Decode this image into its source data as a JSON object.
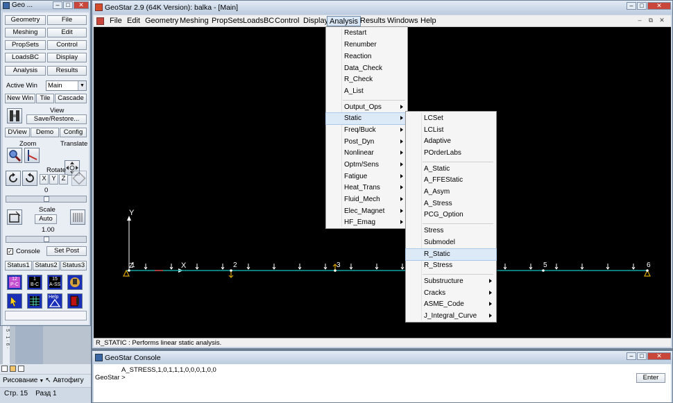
{
  "tool_window": {
    "title": "Geo ...",
    "buttons": [
      [
        "Geometry",
        "File"
      ],
      [
        "Meshing",
        "Edit"
      ],
      [
        "PropSets",
        "Control"
      ],
      [
        "LoadsBC",
        "Display"
      ],
      [
        "Analysis",
        "Results"
      ]
    ],
    "active_win_label": "Active Win",
    "active_win_value": "Main",
    "win_buttons": [
      "New Win",
      "Tile",
      "Cascade"
    ],
    "view_label": "View",
    "save_restore": "Save/Restore...",
    "view_buttons": [
      "DView",
      "Demo",
      "Config"
    ],
    "zoom_label": "Zoom",
    "translate_label": "Translate",
    "rotate_label": "Rotate",
    "axes": [
      "X",
      "Y",
      "Z"
    ],
    "rotate_value": "0",
    "scale_label": "Scale",
    "scale_auto": "Auto",
    "scale_value": "1.00",
    "console_checkbox": "Console",
    "set_post": "Set Post",
    "status_buttons": [
      "Status1",
      "Status2",
      "Status3"
    ],
    "badge_texts": [
      "12\nP-C",
      "1\nB-C",
      "15\nA-SS",
      "Help"
    ]
  },
  "main_window": {
    "title": "GeoStar 2.9 (64K Version): balka - [Main]",
    "menu": [
      "File",
      "Edit",
      "Geometry",
      "Meshing",
      "PropSets",
      "LoadsBC",
      "Control",
      "Display",
      "Analysis",
      "Results",
      "Windows",
      "Help"
    ],
    "active_menu": "Analysis",
    "status_text": "R_STATIC : Performs linear static analysis."
  },
  "analysis_menu": {
    "group1": [
      "Restart",
      "Renumber",
      "Reaction",
      "Data_Check",
      "R_Check",
      "A_List"
    ],
    "group2": [
      "Output_Ops",
      "Static",
      "Freq/Buck",
      "Post_Dyn",
      "Nonlinear",
      "Optm/Sens",
      "Fatigue",
      "Heat_Trans",
      "Fluid_Mech",
      "Elec_Magnet",
      "HF_Emag"
    ],
    "highlighted": "Static"
  },
  "static_submenu": {
    "group1": [
      "LCSet",
      "LCList",
      "Adaptive",
      "POrderLabs"
    ],
    "group2": [
      "A_Static",
      "A_FFEStatic",
      "A_Asym",
      "A_Stress",
      "PCG_Option"
    ],
    "group3": [
      "Stress",
      "Submodel",
      "R_Static",
      "R_Stress"
    ],
    "group4": [
      "Substructure",
      "Cracks",
      "ASME_Code",
      "J_Integral_Curve"
    ],
    "highlighted": "R_Static"
  },
  "canvas": {
    "axis_y": "Y",
    "axis_x": "X",
    "axis_origin": "Z",
    "node_labels": [
      "1",
      "2",
      "3",
      "5",
      "6"
    ]
  },
  "console": {
    "title": "GeoStar Console",
    "line1": "A_STRESS,1,0,1,1,1,0,0,0,1,0,0",
    "prompt": "GeoStar >",
    "enter": "Enter"
  },
  "word_strip": {
    "draw": "Рисование",
    "autoshapes": "Автофигу",
    "page": "Стр. 15",
    "section": "Разд 1",
    "ruler": "· 5 · 1 · 6 ·"
  },
  "colors": {
    "canvas_bg": "#000000",
    "beam": "#14a3a3",
    "load_arrows": "#ffffff",
    "support": "#d8a500"
  }
}
